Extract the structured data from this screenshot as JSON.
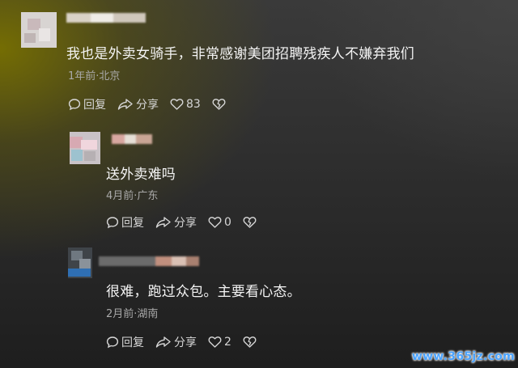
{
  "comments": [
    {
      "text": "我也是外卖女骑手，非常感谢美团招聘残疾人不嫌弃我们",
      "meta": "1年前·北京",
      "reply_label": "回复",
      "share_label": "分享",
      "like_count": "83"
    },
    {
      "text": "送外卖难吗",
      "meta": "4月前·广东",
      "reply_label": "回复",
      "share_label": "分享",
      "like_count": "0"
    },
    {
      "text": "很难，跑过众包。主要看心态。",
      "meta": "2月前·湖南",
      "reply_label": "回复",
      "share_label": "分享",
      "like_count": "2"
    }
  ],
  "watermark": "www.365jz.com",
  "icons": [
    "comment-icon",
    "share-icon",
    "like-heart-icon",
    "dislike-heart-icon"
  ],
  "colors": {
    "watermark": "#4aa3ff",
    "meta_text": "#a9a9a9"
  }
}
